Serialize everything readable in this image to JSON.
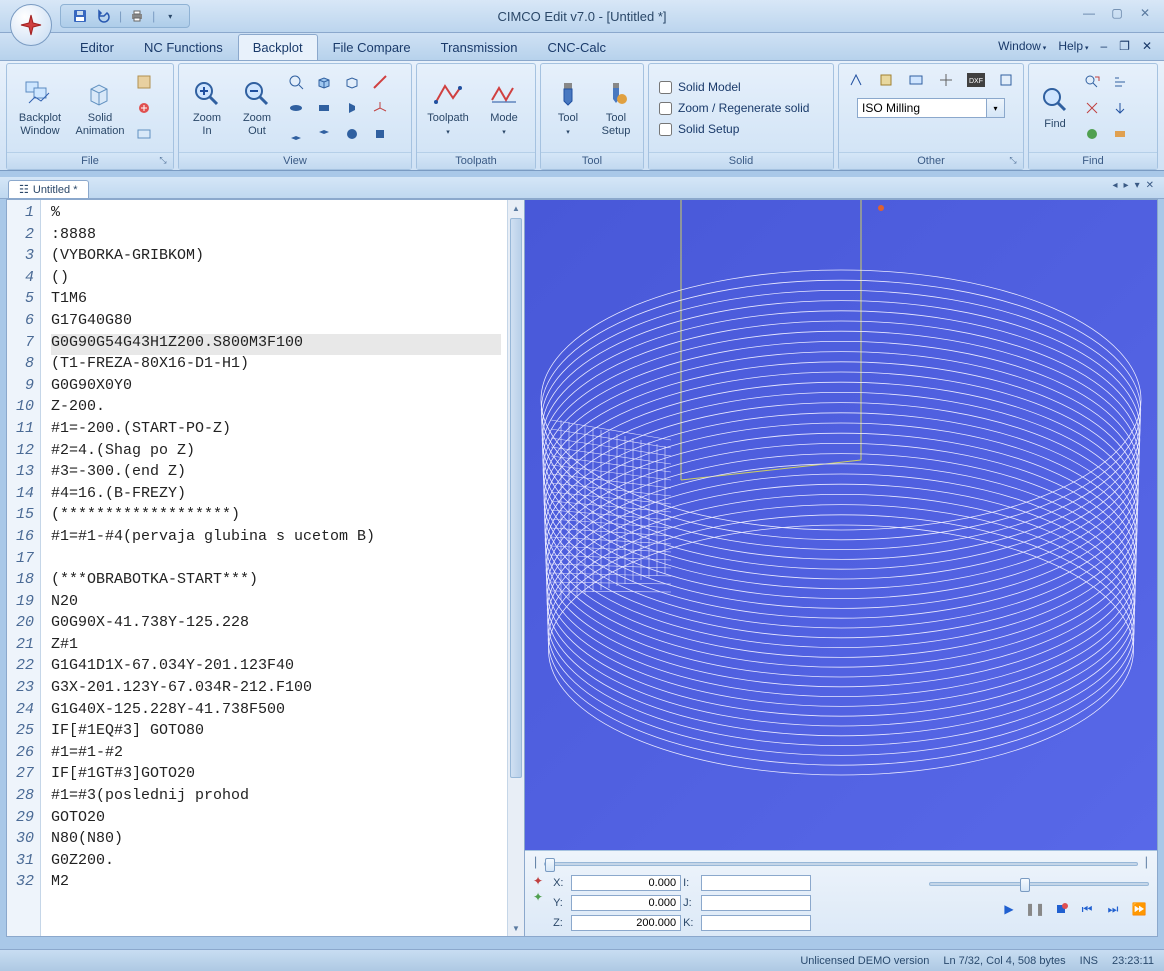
{
  "title": "CIMCO Edit v7.0 - [Untitled *]",
  "qat": {
    "save": "save",
    "undo": "undo",
    "print": "print"
  },
  "tabs": {
    "items": [
      "Editor",
      "NC Functions",
      "Backplot",
      "File Compare",
      "Transmission",
      "CNC-Calc"
    ],
    "active": 2
  },
  "menubar_right": {
    "window": "Window",
    "help": "Help"
  },
  "ribbon": {
    "file": {
      "title": "File",
      "backplot_window": "Backplot\nWindow",
      "solid_animation": "Solid\nAnimation"
    },
    "view": {
      "title": "View",
      "zoom_in": "Zoom\nIn",
      "zoom_out": "Zoom\nOut"
    },
    "toolpath": {
      "title": "Toolpath",
      "toolpath_btn": "Toolpath",
      "mode_btn": "Mode"
    },
    "tool": {
      "title": "Tool",
      "tool_btn": "Tool",
      "tool_setup": "Tool\nSetup"
    },
    "solid": {
      "title": "Solid",
      "solid_model": "Solid Model",
      "zoom_regen": "Zoom / Regenerate solid",
      "solid_setup": "Solid Setup"
    },
    "other": {
      "title": "Other",
      "combo_value": "ISO Milling"
    },
    "find": {
      "title": "Find",
      "find_btn": "Find"
    }
  },
  "doc_tab": "Untitled *",
  "code_lines": [
    "%",
    ":8888",
    "(VYBORKA-GRIBKOM)",
    "()",
    "T1M6",
    "G17G40G80",
    "G0G90G54G43H1Z200.S800M3F100",
    "(T1-FREZA-80X16-D1-H1)",
    "G0G90X0Y0",
    "Z-200.",
    "#1=-200.(START-PO-Z)",
    "#2=4.(Shag po Z)",
    "#3=-300.(end Z)",
    "#4=16.(B-FREZY)",
    "(*******************)",
    "#1=#1-#4(pervaja glubina s ucetom B)",
    "",
    "(***OBRABOTKA-START***)",
    "N20",
    "G0G90X-41.738Y-125.228",
    "Z#1",
    "G1G41D1X-67.034Y-201.123F40",
    "G3X-201.123Y-67.034R-212.F100",
    "G1G40X-125.228Y-41.738F500",
    "IF[#1EQ#3] GOTO80",
    "#1=#1-#2",
    "IF[#1GT#3]GOTO20",
    "#1=#3(poslednij prohod",
    "GOTO20",
    "N80(N80)",
    "G0Z200.",
    "M2"
  ],
  "highlight_line": 7,
  "line_count": 32,
  "coords": {
    "X": "0.000",
    "Y": "0.000",
    "Z": "200.000",
    "I": "",
    "J": "",
    "K": ""
  },
  "status": {
    "demo": "Unlicensed DEMO version",
    "pos": "Ln 7/32, Col 4, 508 bytes",
    "ins": "INS",
    "time": "23:23:11"
  }
}
